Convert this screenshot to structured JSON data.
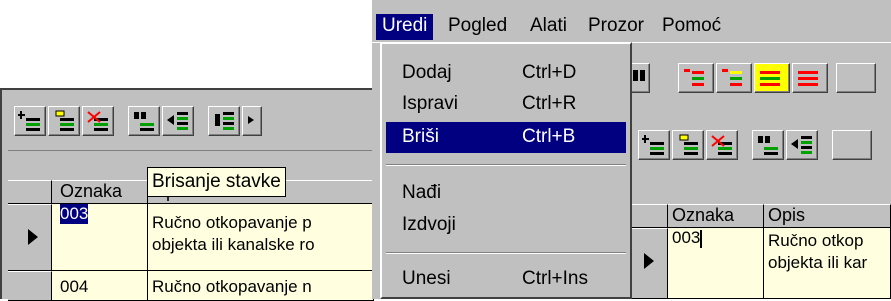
{
  "tooltip": "Brisanje stavke",
  "left": {
    "columns": [
      "Oznaka",
      "Opis"
    ],
    "rows": [
      {
        "code": "003",
        "desc_line1": "Ručno otkopavanje p",
        "desc_line2": "objekta ili kanalske ro"
      },
      {
        "code": "004",
        "desc_line1": "Ručno otkopavanje n",
        "desc_line2": ""
      }
    ]
  },
  "menubar": {
    "items": [
      {
        "label": "Uredi",
        "active": true
      },
      {
        "label": "Pogled"
      },
      {
        "label": "Alati"
      },
      {
        "label": "Prozor"
      },
      {
        "label": "Pomoć"
      }
    ]
  },
  "dropdown": {
    "items": [
      {
        "label": "Dodaj",
        "shortcut": "Ctrl+D"
      },
      {
        "label": "Ispravi",
        "shortcut": "Ctrl+R"
      },
      {
        "label": "Briši",
        "shortcut": "Ctrl+B",
        "highlighted": true
      },
      {
        "label": "Nađi",
        "shortcut": ""
      },
      {
        "label": "Izdvoji",
        "shortcut": ""
      },
      {
        "label": "Unesi",
        "shortcut": "Ctrl+Ins"
      }
    ]
  },
  "right": {
    "columns": [
      "Oznaka",
      "Opis"
    ],
    "rows": [
      {
        "code": "003",
        "desc_line1": "Ručno otkop",
        "desc_line2": "objekta ili kar"
      }
    ]
  },
  "colors": {
    "menu_highlight": "#000080",
    "row_yellow": "#ffffe0",
    "icon_green": "#00a000",
    "icon_red": "#ff0000",
    "icon_yellow": "#ffff00"
  },
  "icons": [
    "add-row-icon",
    "edit-row-icon",
    "delete-row-icon",
    "find-icon",
    "filter-icon",
    "insert-icon",
    "tree-icon"
  ]
}
